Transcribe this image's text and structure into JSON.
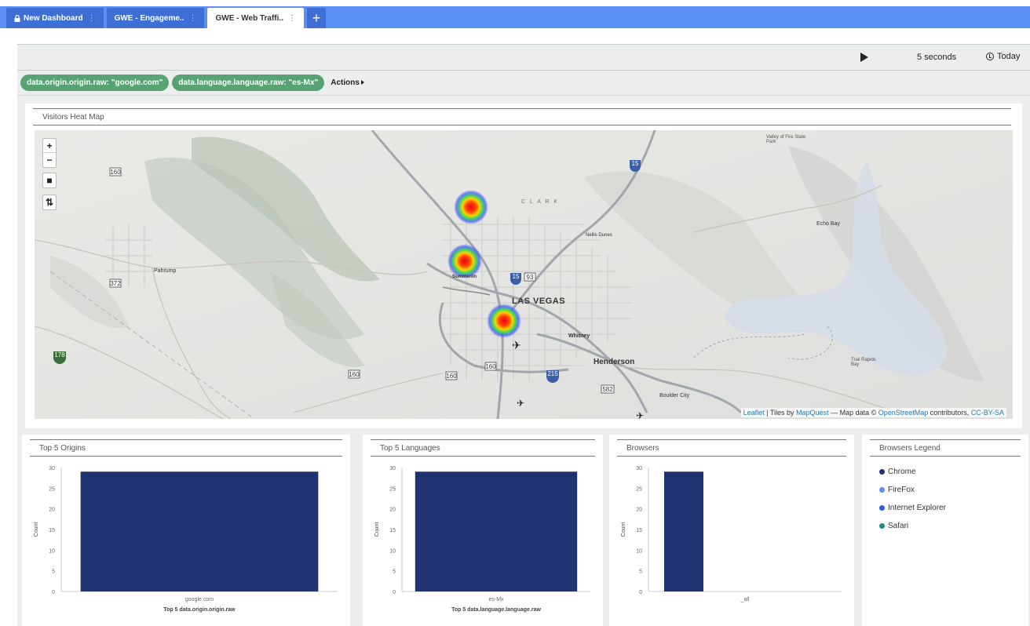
{
  "tabs": [
    {
      "label": "New Dashboard",
      "locked": true,
      "active": false
    },
    {
      "label": "GWE - Engageme..",
      "locked": false,
      "active": false
    },
    {
      "label": "GWE - Web Traffi..",
      "locked": false,
      "active": true
    }
  ],
  "add_tab_label": "+",
  "toolbar": {
    "interval": "5 seconds",
    "time": "Today"
  },
  "filters": [
    "data.origin.origin.raw: \"google.com\"",
    "data.language.language.raw: \"es-Mx\""
  ],
  "actions_label": "Actions",
  "map": {
    "title": "Visitors Heat Map",
    "controls": [
      "+",
      "−",
      "■",
      "⇅"
    ],
    "labels": [
      {
        "text": "LAS VEGAS",
        "key": "lv"
      },
      {
        "text": "Henderson",
        "key": "hd"
      },
      {
        "text": "Pahrump",
        "key": "pa"
      },
      {
        "text": "Summerlin",
        "key": "su"
      },
      {
        "text": "Whitney",
        "key": "wh"
      },
      {
        "text": "Boulder City",
        "key": "bc"
      },
      {
        "text": "Echo Bay",
        "key": "eb"
      },
      {
        "text": "Nellis Dunes",
        "key": "nd"
      },
      {
        "text": "C L A R K",
        "key": "cl"
      },
      {
        "text": "Valley of Fire State Park",
        "key": "vf"
      },
      {
        "text": "Trail Rapids Bay",
        "key": "tr"
      }
    ],
    "route_shields": [
      "160",
      "372",
      "160",
      "160",
      "160",
      "15",
      "15",
      "93",
      "215",
      "582",
      "178"
    ],
    "attribution": {
      "leaflet": "Leaflet",
      "tiles_by": " | Tiles by ",
      "mapquest": "MapQuest",
      "mapdata": " — Map data © ",
      "osm": "OpenStreetMap",
      "contrib": " contributors, ",
      "license": "CC-BY-SA"
    },
    "heat_points": [
      {
        "label": "north",
        "intensity": 1.0
      },
      {
        "label": "summerlin",
        "intensity": 1.0
      },
      {
        "label": "strip",
        "intensity": 1.0
      }
    ]
  },
  "chart_data": [
    {
      "type": "bar",
      "panel_title": "Top 5 Origins",
      "categories": [
        "google.com"
      ],
      "values": [
        29
      ],
      "xlabel": "Top 5 data.origin.origin.raw",
      "ylabel": "Count",
      "ylim": [
        0,
        30
      ],
      "yticks": [
        0,
        5,
        10,
        15,
        20,
        25,
        30
      ],
      "color": "#1f3370"
    },
    {
      "type": "bar",
      "panel_title": "Top 5 Languages",
      "categories": [
        "es-Mx"
      ],
      "values": [
        29
      ],
      "xlabel": "Top 5 data.language.language.raw",
      "ylabel": "Count",
      "ylim": [
        0,
        30
      ],
      "yticks": [
        0,
        5,
        10,
        15,
        20,
        25,
        30
      ],
      "color": "#1f3370"
    },
    {
      "type": "bar",
      "panel_title": "Browsers",
      "categories": [
        "_all"
      ],
      "values": [
        29
      ],
      "xlabel": "",
      "ylabel": "Count",
      "ylim": [
        0,
        30
      ],
      "yticks": [
        0,
        5,
        10,
        15,
        20,
        25,
        30
      ],
      "color": "#1f3370"
    }
  ],
  "legend": {
    "title": "Browsers Legend",
    "items": [
      {
        "label": "Chrome",
        "color": "#1f3370"
      },
      {
        "label": "FireFox",
        "color": "#5b8ff3"
      },
      {
        "label": "Internet Explorer",
        "color": "#2f5fd0"
      },
      {
        "label": "Safari",
        "color": "#1e8a8a"
      }
    ]
  }
}
